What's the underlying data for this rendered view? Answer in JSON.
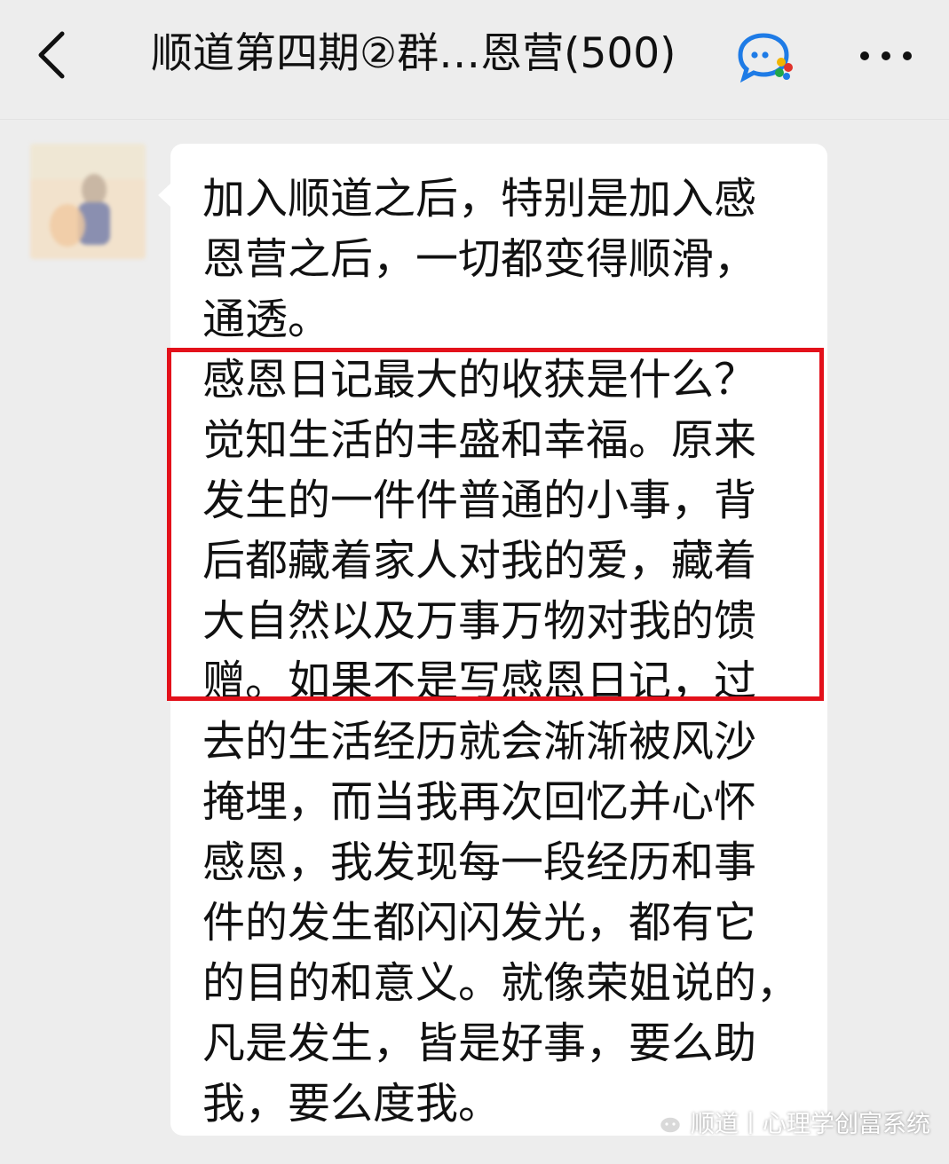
{
  "header": {
    "back_icon": "chevron-left-icon",
    "title": "顺道第四期②群…恩营(500)",
    "title_icon": "chat-bubble-colorful-icon",
    "more_icon": "more-dots-icon"
  },
  "message": {
    "avatar_icon": "blurred-avatar",
    "lines": [
      "加入顺道之后，特别是加入感",
      "恩营之后，一切都变得顺滑，",
      "通透。",
      "感恩日记最大的收获是什么？",
      "觉知生活的丰盛和幸福。原来",
      "发生的一件件普通的小事，背",
      "后都藏着家人对我的爱，藏着",
      "大自然以及万事万物对我的馈",
      "赠。如果不是写感恩日记，过",
      "去的生活经历就会渐渐被风沙",
      "掩埋，而当我再次回忆并心怀",
      "感恩，我发现每一段经历和事",
      "件的发生都闪闪发光，都有它",
      "的目的和意义。就像荣姐说的，",
      "凡是发生，皆是好事，要么助",
      "我，要么度我。"
    ],
    "highlight_color": "#e3111b"
  },
  "watermark": {
    "icon": "wechat-icon",
    "text": "顺道丨心理学创富系统"
  }
}
